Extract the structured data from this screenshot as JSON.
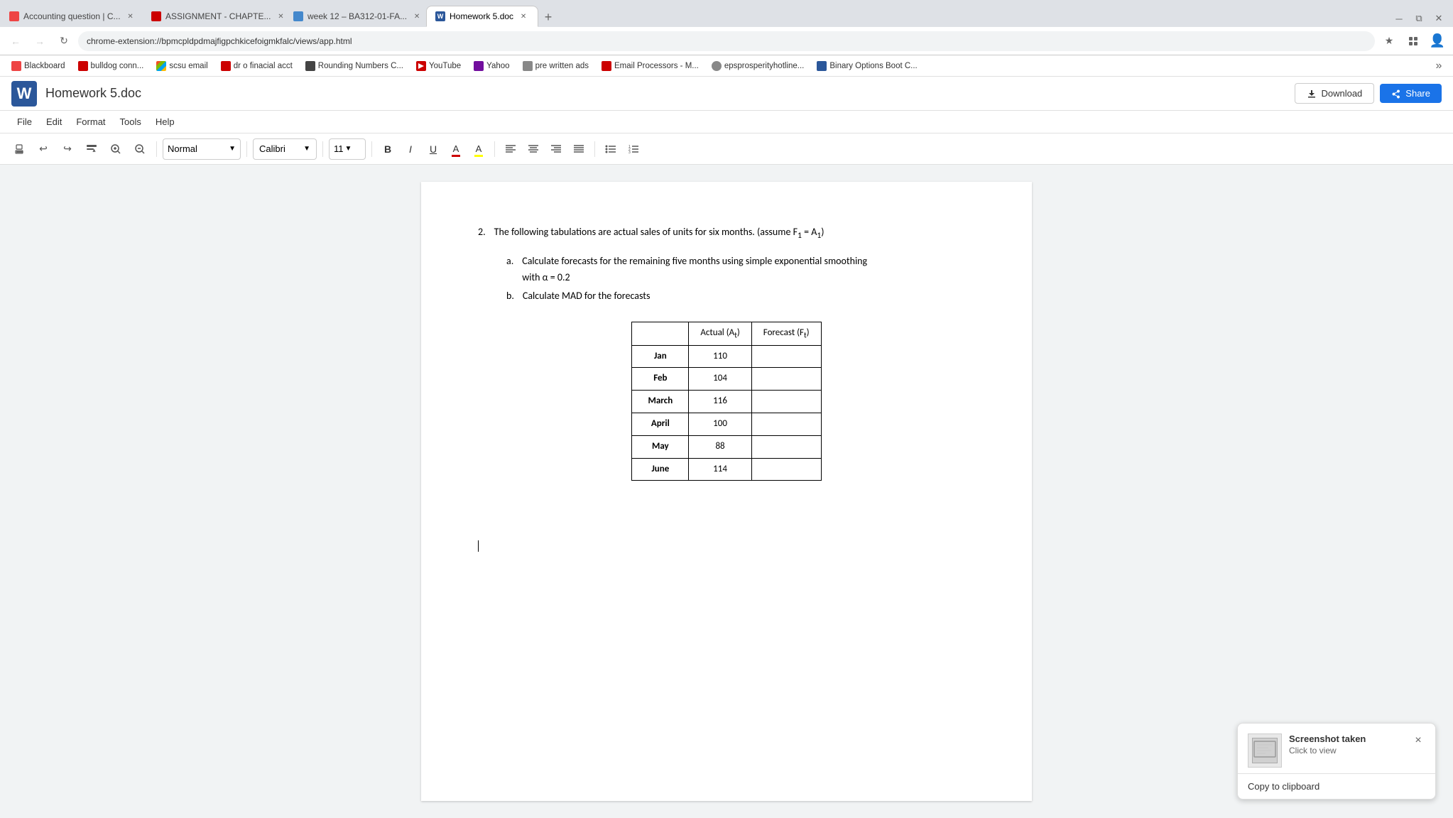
{
  "browser": {
    "tabs": [
      {
        "id": "tab1",
        "label": "Accounting question | C...",
        "favicon_color": "#e44",
        "active": false
      },
      {
        "id": "tab2",
        "label": "ASSIGNMENT - CHAPTE...",
        "favicon_color": "#c00",
        "active": false
      },
      {
        "id": "tab3",
        "label": "week 12 – BA312-01-FA...",
        "favicon_color": "#4488cc",
        "active": false
      },
      {
        "id": "tab4",
        "label": "Homework 5.doc",
        "favicon_color": "#2b579a",
        "active": true
      }
    ],
    "url": "chrome-extension://bpmcpldpdmajfigpchkicefoigmkfalc/views/app.html"
  },
  "bookmarks": [
    {
      "id": "bm1",
      "label": "Blackboard",
      "color": "#c00"
    },
    {
      "id": "bm2",
      "label": "bulldog conn...",
      "color": "#c00"
    },
    {
      "id": "bm3",
      "label": "scsu email",
      "color": "#00a4ef"
    },
    {
      "id": "bm4",
      "label": "dr o finacial acct",
      "color": "#c00"
    },
    {
      "id": "bm5",
      "label": "Rounding Numbers C...",
      "color": "#444"
    },
    {
      "id": "bm6",
      "label": "YouTube",
      "color": "#c00"
    },
    {
      "id": "bm7",
      "label": "Yahoo",
      "color": "#720e9e"
    },
    {
      "id": "bm8",
      "label": "pre written ads",
      "color": "#888"
    },
    {
      "id": "bm9",
      "label": "Email Processors - M...",
      "color": "#c00"
    },
    {
      "id": "bm10",
      "label": "epsprosperityhotline...",
      "color": "#888"
    },
    {
      "id": "bm11",
      "label": "Binary Options Boot C...",
      "color": "#2b579a"
    }
  ],
  "app": {
    "title": "Homework 5.doc",
    "logo": "W",
    "download_label": "Download",
    "share_label": "Share",
    "menu_items": [
      "File",
      "Edit",
      "Format",
      "Tools",
      "Help"
    ]
  },
  "toolbar": {
    "style_label": "Normal",
    "font_label": "Calibri",
    "size_label": "11",
    "bold": "B",
    "italic": "I",
    "underline": "U"
  },
  "document": {
    "question_number": "2.",
    "question_text": "The following tabulations are actual sales of units for six months. (assume F",
    "question_sub1": "= A",
    "question_sub2": "1",
    "question_close": ")",
    "part_a_label": "a.",
    "part_a_text": "Calculate forecasts for the remaining five months using simple exponential smoothing",
    "part_a_text2": "with α = 0.2",
    "part_b_label": "b.",
    "part_b_text": "Calculate MAD for the forecasts",
    "table": {
      "headers": [
        "",
        "Actual (A",
        "Forecast (F"
      ],
      "header_subs": [
        "",
        "t",
        "t"
      ],
      "header_close": [
        "",
        ")",
        ")"
      ],
      "rows": [
        {
          "month": "Jan",
          "actual": "110",
          "forecast": ""
        },
        {
          "month": "Feb",
          "actual": "104",
          "forecast": ""
        },
        {
          "month": "March",
          "actual": "116",
          "forecast": ""
        },
        {
          "month": "April",
          "actual": "100",
          "forecast": ""
        },
        {
          "month": "May",
          "actual": "88",
          "forecast": ""
        },
        {
          "month": "June",
          "actual": "114",
          "forecast": ""
        }
      ]
    }
  },
  "screenshot_notification": {
    "title": "Screenshot taken",
    "subtitle": "Click to view",
    "copy_label": "Copy to clipboard",
    "close_label": "×"
  }
}
